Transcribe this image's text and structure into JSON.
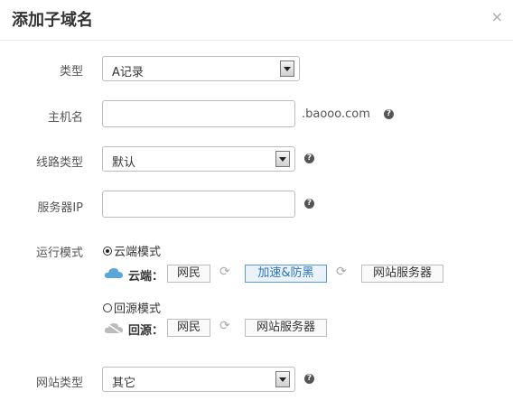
{
  "dialog": {
    "title": "添加子域名",
    "close": "×"
  },
  "form": {
    "record_type": {
      "label": "类型",
      "value": "A记录"
    },
    "host": {
      "label": "主机名",
      "value": "",
      "suffix": ".baooo.com"
    },
    "line_type": {
      "label": "线路类型",
      "value": "默认"
    },
    "server_ip": {
      "label": "服务器IP",
      "value": ""
    },
    "run_mode": {
      "label": "运行模式",
      "cloud": {
        "option": "云端模式",
        "flow_label": "云端：",
        "nodes": [
          "网民",
          "加速&防黑",
          "网站服务器"
        ]
      },
      "origin": {
        "option": "回源模式",
        "flow_label": "回源：",
        "nodes": [
          "网民",
          "网站服务器"
        ]
      }
    },
    "site_type": {
      "label": "网站类型",
      "value": "其它"
    }
  },
  "help_glyph": "?",
  "colors": {
    "accent": "#2e75b6",
    "active_cloud": "#5aa6d8",
    "inactive_cloud": "#bbbbbb"
  }
}
